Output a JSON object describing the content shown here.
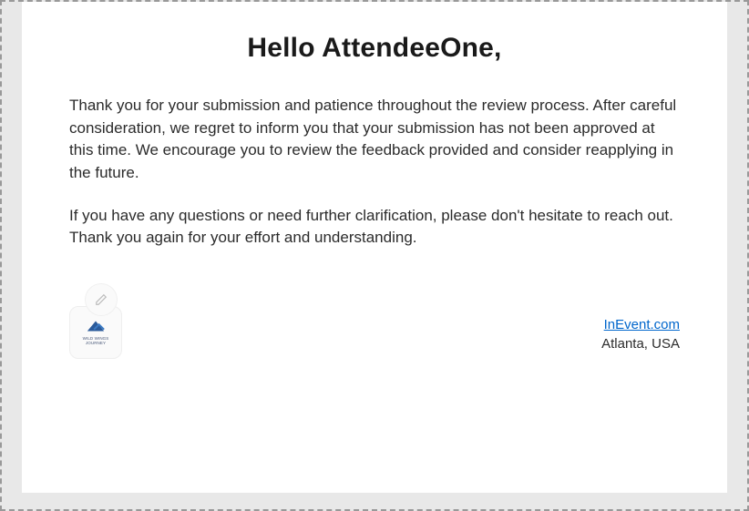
{
  "greeting": "Hello AttendeeOne,",
  "paragraphs": [
    "Thank you for your submission and patience throughout the review process. After careful consideration, we regret to inform you that your submission has not been approved at this time. We encourage you to review the feedback provided and consider reapplying in the future.",
    "If you have any questions or need further clarification, please don't hesitate to reach out. Thank you again for your effort and understanding."
  ],
  "logo_caption": "WILD WINGS JOURNEY",
  "company": {
    "link_text": "InEvent.com",
    "location": "Atlanta, USA"
  }
}
